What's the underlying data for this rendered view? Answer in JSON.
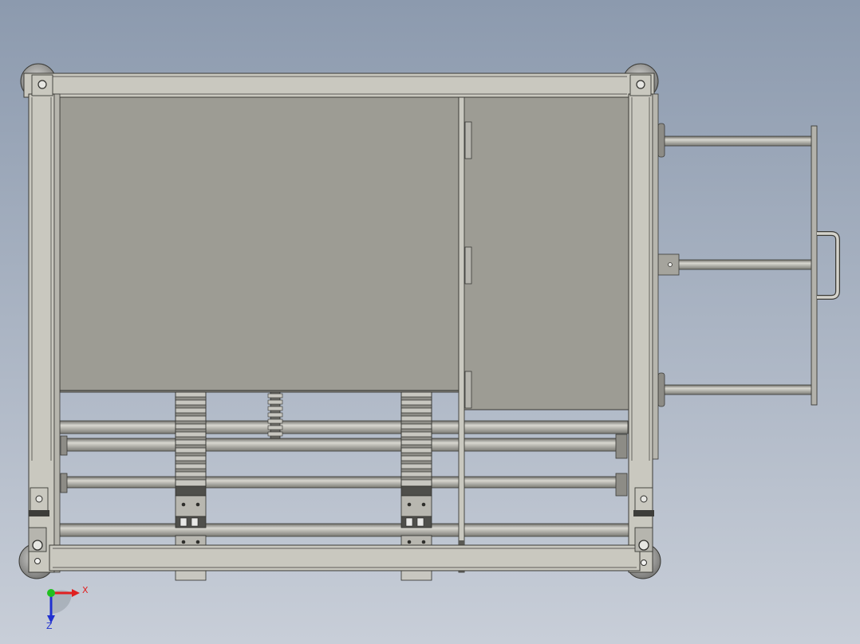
{
  "viewport": {
    "background_top": "#8c9aae",
    "background_bottom": "#c8ced8"
  },
  "model": {
    "frame_color": "#c9c8bf",
    "frame_dark": "#8f8e86",
    "panel_color": "#9d9c94",
    "rod_color": "#b8b7b0",
    "outline": "#3a3a36",
    "caster_color": "#a8a8a6"
  },
  "triad": {
    "x_label": "X",
    "z_label": "Z",
    "x_color": "#e02020",
    "z_color": "#2030d0",
    "y_color": "#20c020"
  }
}
